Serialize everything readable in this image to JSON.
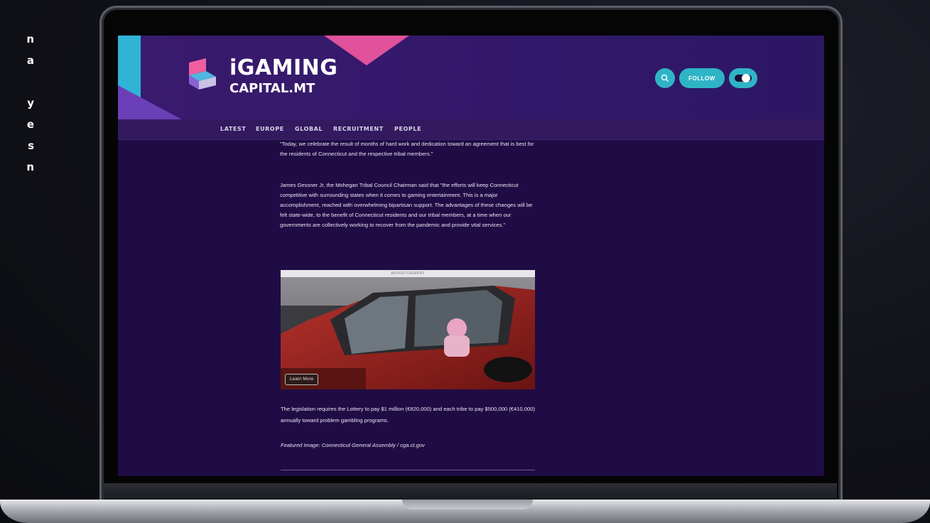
{
  "side_text": [
    "n",
    "a",
    "",
    "y",
    "e",
    "s",
    "n"
  ],
  "site": {
    "logo_line1": "iGAMING",
    "logo_line2": "CAPITAL.MT",
    "follow_label": "FOLLOW",
    "search_icon": "search-icon",
    "toggle_icon": "dark-mode-toggle"
  },
  "nav": {
    "items": [
      "LATEST",
      "EUROPE",
      "GLOBAL",
      "RECRUITMENT",
      "PEOPLE"
    ]
  },
  "article": {
    "quote_cut": "\"Today, we celebrate the result of months of hard work and dedication toward an agreement that is best for the residents of Connecticut and the respective tribal members.\"",
    "paragraph2": "James Gessner Jr, the Mohegan Tribal Council Chairman said that \"the efforts will keep Connecticut competitive with surrounding states when it comes to gaming entertainment. This is a major accomplishment, reached with overwhelming bipartisan support. The advantages of these changes will be felt state-wide, to the benefit of Connecticut residents and our tribal members, at a time when our governments are collectively working to recover from the pandemic and provide vital services.\"",
    "ad_label": "ADVERTISEMENT",
    "ad_button": "Learn More",
    "paragraph3": "The legislation requires the Lottery to pay $1 million (€820,000) and each tribe to pay $500,000 (€410,000) annually toward problem gambling programs.",
    "caption": "Featured Image: Connecticut General Assembly / cga.ct.gov"
  },
  "colors": {
    "page_bg": "#200c44",
    "header_bg": "#32186a",
    "accent_teal": "#2fb4c6",
    "accent_pink": "#e0529b",
    "accent_purple": "#6b3fb8"
  }
}
